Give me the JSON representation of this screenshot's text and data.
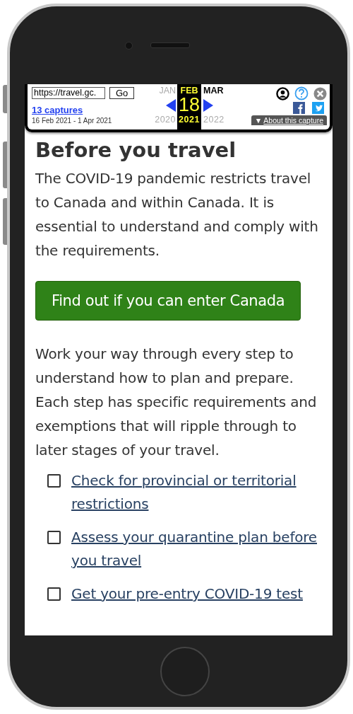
{
  "toolbar": {
    "url": "https://travel.gc.",
    "go": "Go",
    "captures": "13 captures",
    "range": "16 Feb 2021 - 1 Apr 2021",
    "months": [
      {
        "label": "JAN",
        "year": "2020",
        "selected": false
      },
      {
        "label": "FEB",
        "day": "18",
        "year": "2021",
        "selected": true
      },
      {
        "label": "MAR",
        "year": "2022",
        "selected": false
      }
    ],
    "about_marker": "▼",
    "about": "About this capture"
  },
  "heading": "Before you travel",
  "intro": "The COVID-19 pandemic restricts travel to Canada and within Canada. It is essential to understand and comply with the requirements.",
  "button": "Find out if you can enter Canada",
  "body": "Work your way through every step to understand how to plan and prepare. Each step has specific requirements and exemptions that will ripple through to later stages of your travel.",
  "checklist": [
    {
      "label": "Check for provincial or territorial restrictions",
      "checked": false
    },
    {
      "label": "Assess your quarantine plan before you travel",
      "checked": false
    },
    {
      "label": "Get your pre-entry COVID-19 test",
      "checked": false
    }
  ]
}
